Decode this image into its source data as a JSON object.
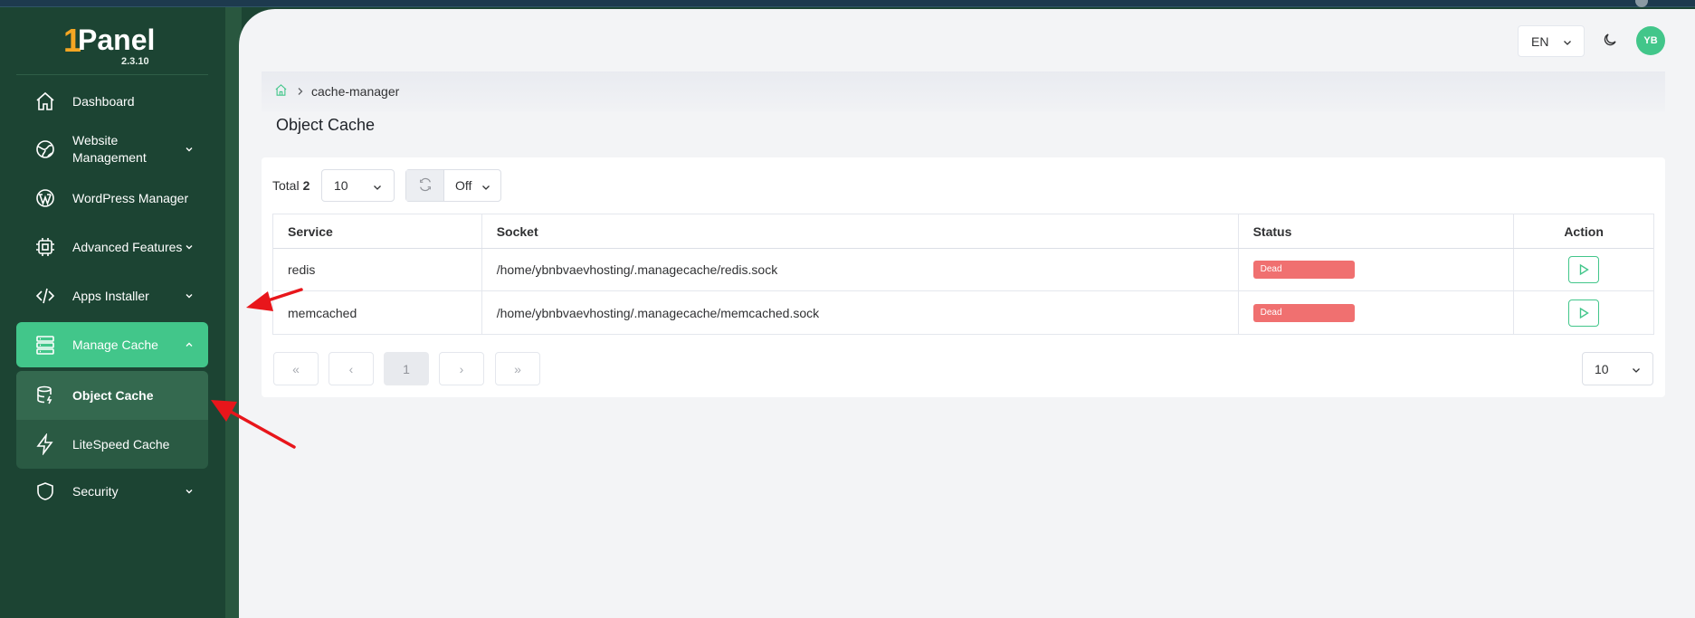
{
  "app": {
    "logo_one": "1",
    "logo_word": "Panel",
    "version": "2.3.10"
  },
  "sidebar": {
    "items": [
      {
        "label": "Dashboard",
        "icon": "home-icon"
      },
      {
        "label": "Website Management",
        "icon": "globe-icon",
        "expandable": true
      },
      {
        "label": "WordPress Manager",
        "icon": "wordpress-icon"
      },
      {
        "label": "Advanced Features",
        "icon": "chip-icon",
        "expandable": true
      },
      {
        "label": "Apps Installer",
        "icon": "code-icon",
        "expandable": true
      },
      {
        "label": "Manage Cache",
        "icon": "server-stack-icon",
        "expandable": true,
        "expanded": true
      },
      {
        "label": "Security",
        "icon": "shield-icon",
        "expandable": true
      }
    ],
    "submenu": [
      {
        "label": "Object Cache",
        "icon": "database-icon",
        "current": true
      },
      {
        "label": "LiteSpeed Cache",
        "icon": "lightning-icon"
      }
    ]
  },
  "header": {
    "language": "EN",
    "avatar_initials": "YB"
  },
  "breadcrumb": {
    "current": "cache-manager"
  },
  "page": {
    "title": "Object Cache"
  },
  "toolbar": {
    "total_label": "Total",
    "total_count": "2",
    "page_size": "10",
    "auto_refresh": "Off"
  },
  "table": {
    "columns": [
      "Service",
      "Socket",
      "Status",
      "Action"
    ],
    "rows": [
      {
        "service": "redis",
        "socket": "/home/ybnbvaevhosting/.managecache/redis.sock",
        "status": "Dead"
      },
      {
        "service": "memcached",
        "socket": "/home/ybnbvaevhosting/.managecache/memcached.sock",
        "status": "Dead"
      }
    ]
  },
  "pagination": {
    "first": "«",
    "prev": "‹",
    "current_page": "1",
    "next": "›",
    "last": "»",
    "page_size": "10"
  },
  "colors": {
    "accent": "#42c68a",
    "sidebar_bg": "#1c4433",
    "status_dead": "#f07070",
    "annotation_arrow": "#e8161b"
  }
}
